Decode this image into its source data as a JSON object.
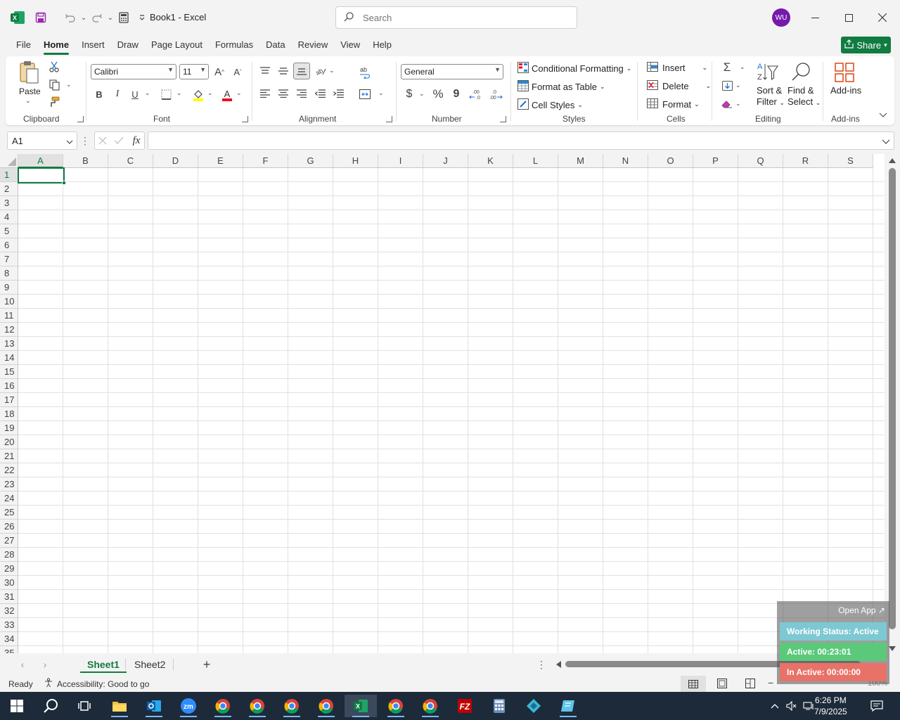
{
  "titlebar": {
    "doc_title": "Book1  -  Excel",
    "search_placeholder": "Search",
    "avatar_initials": "WU"
  },
  "tabs": [
    "File",
    "Home",
    "Insert",
    "Draw",
    "Page Layout",
    "Formulas",
    "Data",
    "Review",
    "View",
    "Help"
  ],
  "active_tab": "Home",
  "share_label": "Share",
  "ribbon": {
    "clipboard": {
      "paste": "Paste",
      "label": "Clipboard"
    },
    "font": {
      "name": "Calibri",
      "size": "11",
      "label": "Font",
      "bold": "B",
      "italic": "I",
      "underline": "U"
    },
    "alignment": {
      "label": "Alignment"
    },
    "number": {
      "format": "General",
      "label": "Number",
      "currency": "$",
      "percent": "%",
      "comma": "9"
    },
    "styles": {
      "conditional": "Conditional Formatting",
      "table": "Format as Table",
      "cell": "Cell Styles",
      "label": "Styles"
    },
    "cells": {
      "insert": "Insert",
      "delete": "Delete",
      "format": "Format",
      "label": "Cells"
    },
    "editing": {
      "sort1": "Sort &",
      "sort2": "Filter",
      "find1": "Find &",
      "find2": "Select",
      "label": "Editing"
    },
    "addins": {
      "name": "Add-ins",
      "label": "Add-ins"
    }
  },
  "formula_bar": {
    "name_box": "A1",
    "fx": "fx",
    "value": ""
  },
  "columns": [
    "A",
    "B",
    "C",
    "D",
    "E",
    "F",
    "G",
    "H",
    "I",
    "J",
    "K",
    "L",
    "M",
    "N",
    "O",
    "P",
    "Q",
    "R",
    "S"
  ],
  "rows": [
    "1",
    "2",
    "3",
    "4",
    "5",
    "6",
    "7",
    "8",
    "9",
    "10",
    "11",
    "12",
    "13",
    "14",
    "15",
    "16",
    "17",
    "18",
    "19",
    "20",
    "21",
    "22",
    "23",
    "24",
    "25",
    "26",
    "27",
    "28",
    "29",
    "30",
    "31",
    "32",
    "33",
    "34",
    "35"
  ],
  "sheets": [
    "Sheet1",
    "Sheet2"
  ],
  "active_sheet": "Sheet1",
  "status": {
    "ready": "Ready",
    "accessibility": "Accessibility: Good to go",
    "zoom": "100%"
  },
  "tracker": {
    "open_app": "Open App ↗",
    "working": "Working Status: Active",
    "active": "Active: 00:23:01",
    "inactive": "In Active: 00:00:00",
    "colors": {
      "working": "#7ec8d3",
      "active": "#5bc97a",
      "inactive": "#e87268"
    }
  },
  "taskbar": {
    "time": "6:26 PM",
    "date": "7/9/2025",
    "apps": [
      "file-explorer",
      "outlook",
      "zoom",
      "chrome",
      "chrome",
      "chrome",
      "chrome",
      "excel",
      "chrome",
      "chrome",
      "filezilla",
      "calculator",
      "app",
      "app"
    ]
  },
  "colors": {
    "excel_green": "#107c41",
    "avatar": "#7719aa",
    "taskbar": "#1c2a3a"
  }
}
